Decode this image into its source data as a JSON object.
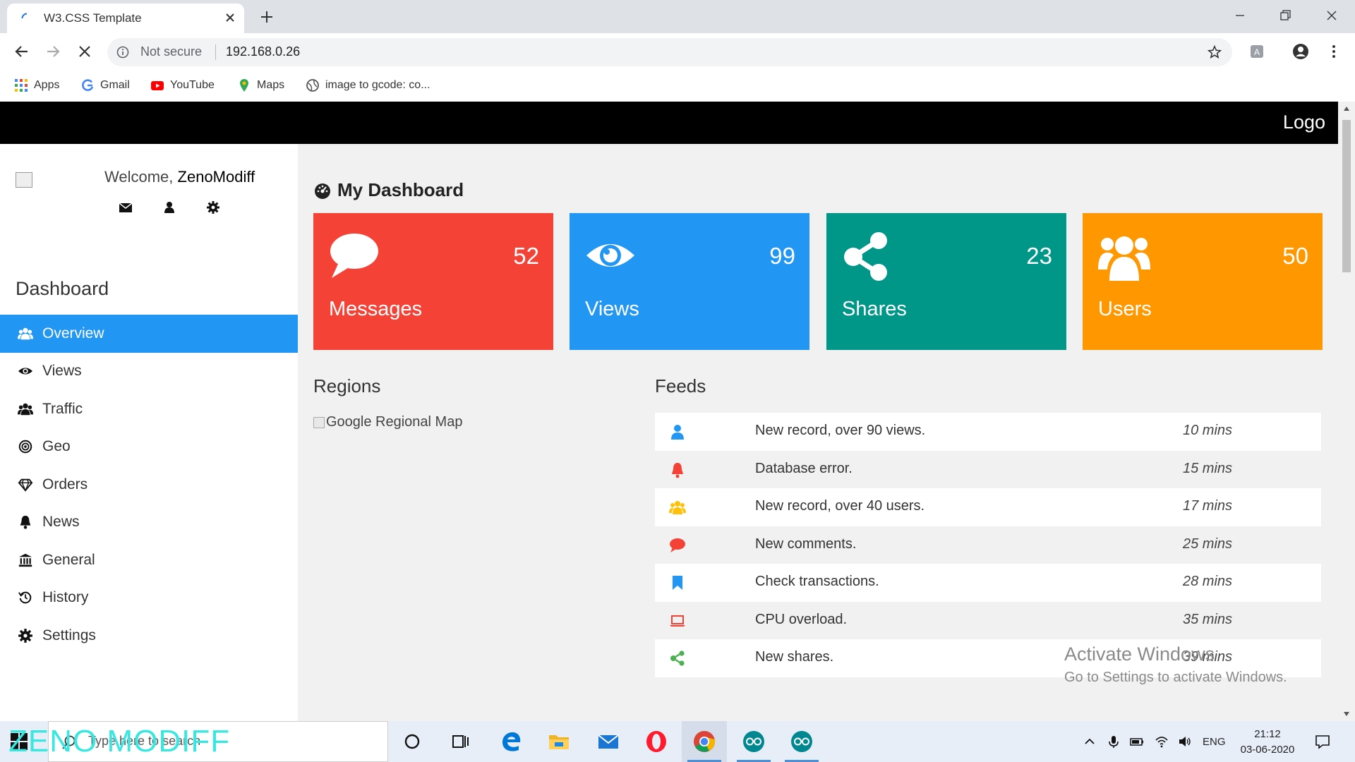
{
  "browser": {
    "tab_title": "W3.CSS Template",
    "security_label": "Not secure",
    "url": "192.168.0.26",
    "bookmarks": [
      {
        "label": "Apps",
        "icon": "apps-grid-icon"
      },
      {
        "label": "Gmail",
        "icon": "google-icon"
      },
      {
        "label": "YouTube",
        "icon": "youtube-icon"
      },
      {
        "label": "Maps",
        "icon": "maps-pin-icon"
      },
      {
        "label": "image to gcode: co...",
        "icon": "globe-icon"
      }
    ]
  },
  "header": {
    "logo": "Logo"
  },
  "sidebar": {
    "welcome_prefix": "Welcome,",
    "username": "ZenoModiff",
    "avatar_alt": "avatar",
    "heading": "Dashboard",
    "items": [
      {
        "label": "Overview",
        "icon": "users-icon",
        "active": true
      },
      {
        "label": "Views",
        "icon": "eye-icon"
      },
      {
        "label": "Traffic",
        "icon": "users-icon"
      },
      {
        "label": "Geo",
        "icon": "bullseye-icon"
      },
      {
        "label": "Orders",
        "icon": "diamond-icon"
      },
      {
        "label": "News",
        "icon": "bell-icon"
      },
      {
        "label": "General",
        "icon": "bank-icon"
      },
      {
        "label": "History",
        "icon": "history-icon"
      },
      {
        "label": "Settings",
        "icon": "gear-icon"
      }
    ]
  },
  "dashboard": {
    "title": "My Dashboard",
    "cards": [
      {
        "label": "Messages",
        "value": "52",
        "color": "#f44336",
        "icon": "comment-icon"
      },
      {
        "label": "Views",
        "value": "99",
        "color": "#2196f3",
        "icon": "eye-icon"
      },
      {
        "label": "Shares",
        "value": "23",
        "color": "#009688",
        "icon": "share-icon"
      },
      {
        "label": "Users",
        "value": "50",
        "color": "#ff9800",
        "icon": "users-icon"
      }
    ],
    "regions_title": "Regions",
    "regions_img_alt": "Google Regional Map",
    "feeds_title": "Feeds",
    "feeds": [
      {
        "text": "New record, over 90 views.",
        "time": "10 mins",
        "icon": "user-icon",
        "color": "#2196f3"
      },
      {
        "text": "Database error.",
        "time": "15 mins",
        "icon": "bell-icon",
        "color": "#f44336"
      },
      {
        "text": "New record, over 40 users.",
        "time": "17 mins",
        "icon": "users-icon",
        "color": "#ffc107"
      },
      {
        "text": "New comments.",
        "time": "25 mins",
        "icon": "comment-icon",
        "color": "#f44336"
      },
      {
        "text": "Check transactions.",
        "time": "28 mins",
        "icon": "bookmark-icon",
        "color": "#2196f3"
      },
      {
        "text": "CPU overload.",
        "time": "35 mins",
        "icon": "laptop-icon",
        "color": "#f44336"
      },
      {
        "text": "New shares.",
        "time": "39 mins",
        "icon": "share-icon",
        "color": "#4caf50"
      }
    ]
  },
  "watermark": {
    "line1": "Activate Windows",
    "line2": "Go to Settings to activate Windows."
  },
  "taskbar": {
    "search_placeholder": "Type here to search",
    "overlay_text": "ZENO MODIFF",
    "tray_lang": "ENG",
    "time": "21:12",
    "date": "03-06-2020"
  }
}
